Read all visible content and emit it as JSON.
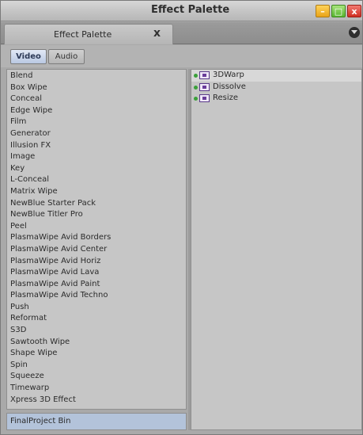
{
  "window": {
    "title": "Effect Palette",
    "controls": {
      "minimize": "–",
      "maximize": "□",
      "close": "x"
    }
  },
  "tab": {
    "label": "Effect Palette",
    "close": "x"
  },
  "filter": {
    "video_label": "Video",
    "audio_label": "Audio",
    "selected": "Video"
  },
  "categories": [
    "Blend",
    "Box Wipe",
    "Conceal",
    "Edge Wipe",
    "Film",
    "Generator",
    "Illusion FX",
    "Image",
    "Key",
    "L-Conceal",
    "Matrix Wipe",
    "NewBlue Starter Pack",
    "NewBlue Titler Pro",
    "Peel",
    "PlasmaWipe Avid Borders",
    "PlasmaWipe Avid Center",
    "PlasmaWipe Avid Horiz",
    "PlasmaWipe Avid Lava",
    "PlasmaWipe Avid Paint",
    "PlasmaWipe Avid Techno",
    "Push",
    "Reformat",
    "S3D",
    "Sawtooth Wipe",
    "Shape Wipe",
    "Spin",
    "Squeeze",
    "Timewarp",
    "Xpress 3D Effect"
  ],
  "bin": {
    "label": "FinalProject Bin"
  },
  "effects": [
    {
      "label": "3DWarp",
      "icon": "effect-icon"
    },
    {
      "label": "Dissolve",
      "icon": "effect-icon"
    },
    {
      "label": "Resize",
      "icon": "effect-icon"
    }
  ],
  "colors": {
    "accent_selected": "#b9c8e2",
    "close_button": "#cf2e22",
    "minimize_button": "#e9a318",
    "maximize_button": "#57b52f"
  }
}
